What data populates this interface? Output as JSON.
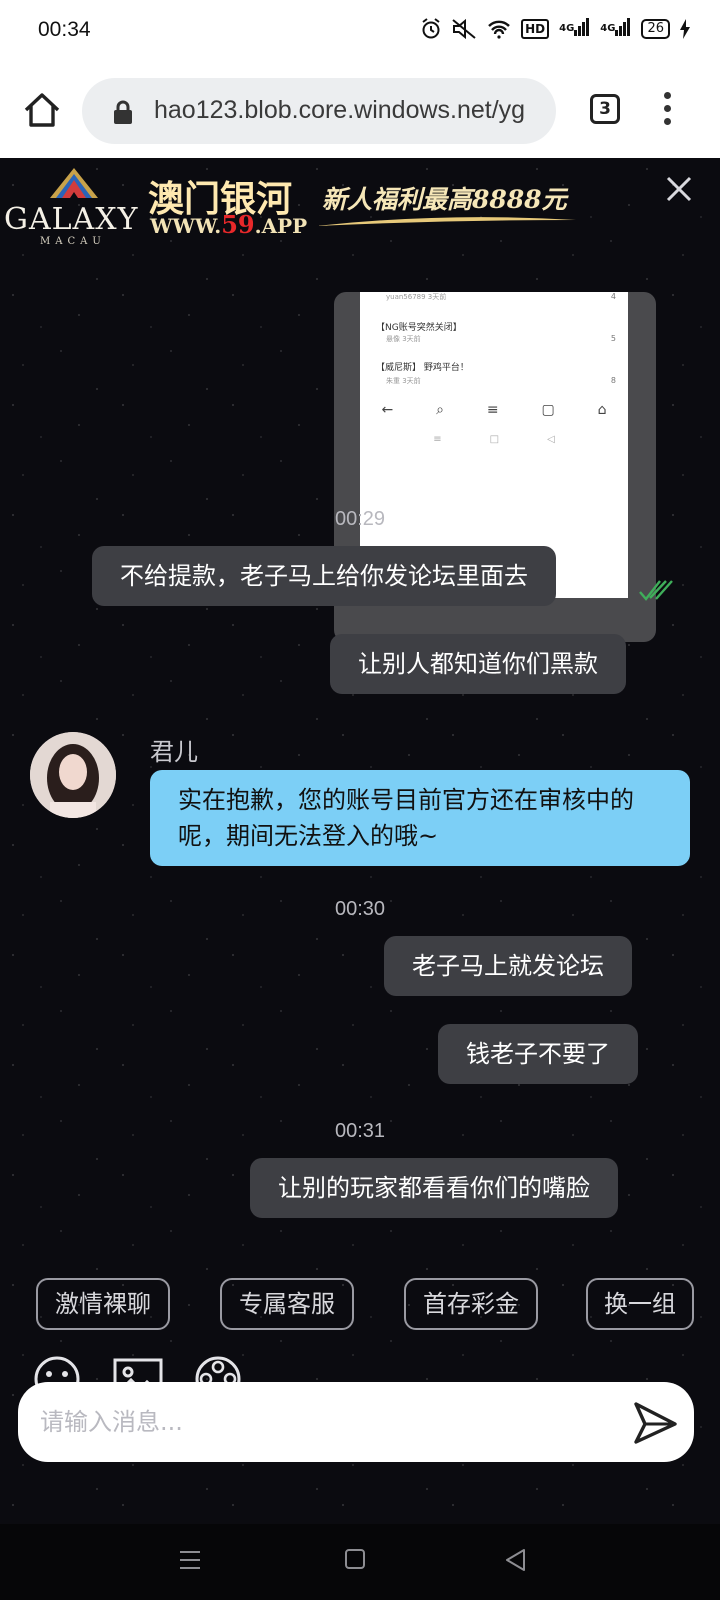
{
  "status_bar": {
    "time": "00:34",
    "signal_1": "4G",
    "signal_2": "4G",
    "hd": "HD",
    "battery": "26"
  },
  "browser": {
    "url": "hao123.blob.core.windows.net/yg",
    "tab_count": "3"
  },
  "banner": {
    "logo_text": "GALAXY",
    "logo_sub": "MACAU",
    "brand_cn": "澳门银河",
    "brand_url_prefix": "WWW.",
    "brand_url_num": "59",
    "brand_url_suffix": ".APP",
    "promo": "新人福利最高8888元"
  },
  "screenshot_msg": {
    "row1_sub": "yuan56789  3天前",
    "row1_count": "4",
    "row2_title": "【NG账号突然关闭】",
    "row2_sub": "悬像  3天前",
    "row2_count": "5",
    "row3_title": "【威尼斯】 野鸡平台！",
    "row3_sub": "朱重  3天前",
    "row3_count": "8"
  },
  "messages": [
    {
      "time": "00:29"
    },
    {
      "text": "不给提款，老子马上给你发论坛里面去"
    },
    {
      "text": "让别人都知道你们黑款"
    },
    {
      "sender": "君儿",
      "text": "实在抱歉，您的账号目前官方还在审核中的呢，期间无法登入的哦~"
    },
    {
      "time": "00:30"
    },
    {
      "text": "老子马上就发论坛"
    },
    {
      "text": "钱老子不要了"
    },
    {
      "time": "00:31"
    },
    {
      "text": "让别的玩家都看看你们的嘴脸"
    }
  ],
  "quick_replies": [
    "激情裸聊",
    "专属客服",
    "首存彩金",
    "换一组"
  ],
  "input": {
    "placeholder": "请输入消息..."
  },
  "colors": {
    "outgoing_bubble": "#3e3f44",
    "incoming_bubble": "#7ccff6",
    "read_check": "#3fae5a"
  }
}
